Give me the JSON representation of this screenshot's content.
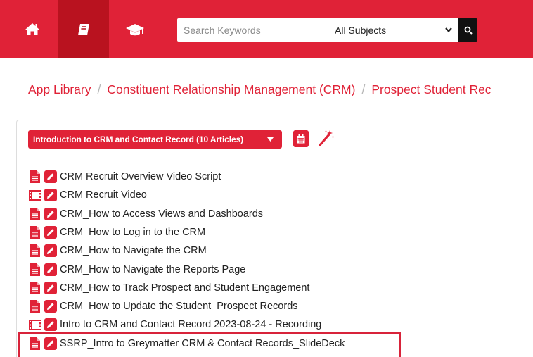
{
  "nav": {
    "items": [
      {
        "icon": "home-icon"
      },
      {
        "icon": "book-icon"
      },
      {
        "icon": "graduation-cap-icon"
      }
    ],
    "search": {
      "placeholder": "Search Keywords",
      "value": ""
    },
    "subject": {
      "selected": "All Subjects"
    },
    "colors": {
      "brand": "#e02237",
      "active": "#b9121f"
    }
  },
  "breadcrumb": {
    "items": [
      "App Library",
      "Constituent Relationship Management (CRM)",
      "Prospect Student Rec"
    ],
    "separator": "/"
  },
  "panel": {
    "dropdown_label": "Introduction to CRM and Contact Record (10 Articles)",
    "calendar_icon": "calendar-icon",
    "wand_icon": "magic-wand-icon"
  },
  "articles": [
    {
      "type": "document",
      "title": "CRM Recruit Overview Video Script"
    },
    {
      "type": "video",
      "title": "CRM Recruit Video"
    },
    {
      "type": "document",
      "title": "CRM_How to Access Views and Dashboards"
    },
    {
      "type": "document",
      "title": "CRM_How to Log in to the CRM"
    },
    {
      "type": "document",
      "title": "CRM_How to Navigate the CRM"
    },
    {
      "type": "document",
      "title": "CRM_How to Navigate the Reports Page"
    },
    {
      "type": "document",
      "title": "CRM_How to Track Prospect and Student Engagement"
    },
    {
      "type": "document",
      "title": "CRM_How to Update the Student_Prospect Records"
    },
    {
      "type": "video",
      "title": "Intro to CRM and Contact Record 2023-08-24 - Recording"
    },
    {
      "type": "document",
      "title": "SSRP_Intro to Greymatter CRM & Contact Records_SlideDeck"
    }
  ]
}
